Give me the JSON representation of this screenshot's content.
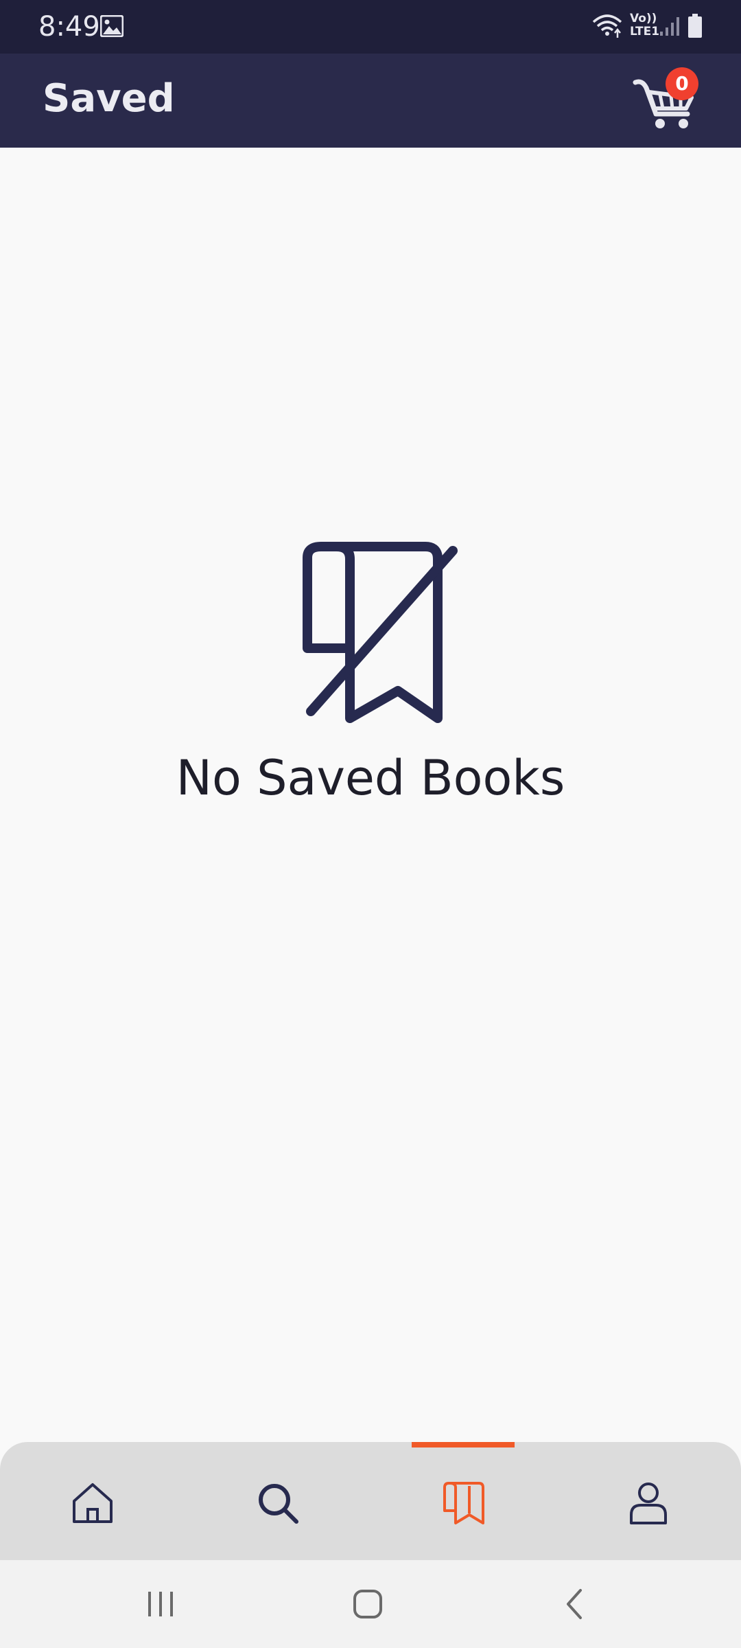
{
  "status_bar": {
    "time": "8:49",
    "network_label_top": "Vo))",
    "network_label_bottom": "LTE1"
  },
  "app_bar": {
    "title": "Saved",
    "cart_count": "0"
  },
  "empty_state": {
    "icon": "bookmark-off-icon",
    "message": "No Saved Books"
  },
  "bottom_nav": {
    "active_index": 2,
    "accent_color": "#f05a28",
    "items": [
      {
        "icon": "home-icon"
      },
      {
        "icon": "search-icon"
      },
      {
        "icon": "saved-book-icon"
      },
      {
        "icon": "profile-icon"
      }
    ]
  },
  "system_nav": {
    "buttons": [
      "recents-icon",
      "home-button-icon",
      "back-icon"
    ]
  },
  "colors": {
    "app_bar": "#2a2a4b",
    "status_bar": "#1f1f3a",
    "badge": "#f0402f",
    "icon_dark": "#272a4f",
    "background": "#f9f9f9"
  }
}
